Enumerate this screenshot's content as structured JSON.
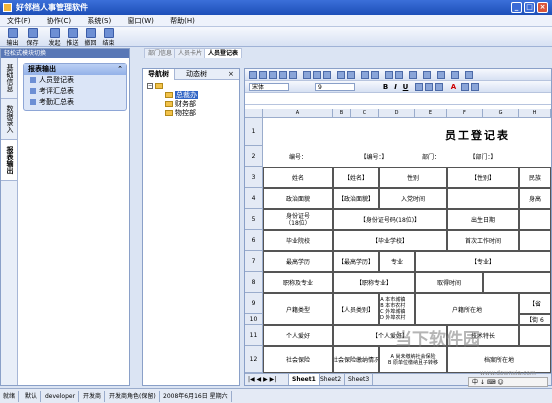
{
  "app": {
    "title": "好邻档人事管理软件",
    "controls": [
      "_",
      "□",
      "×"
    ]
  },
  "menu": [
    "文件(F)",
    "协作(C)",
    "系统(S)",
    "窗口(W)",
    "帮助(H)"
  ],
  "toolbar": [
    "输出",
    "保存",
    "发起",
    "推送",
    "撤回",
    "结束"
  ],
  "left_panel": {
    "title": "轻松式模块切换",
    "vtabs": [
      "基础信息",
      "数据录入",
      "报表输出"
    ],
    "active_vtab": "报表输出",
    "section": {
      "title": "报表输出",
      "items": [
        "人员登记表",
        "考评汇总表",
        "考勤汇总表"
      ]
    }
  },
  "doc_tabs": [
    "部门信息",
    "人员卡片",
    "人员登记表"
  ],
  "tree": {
    "tabs": [
      "导航树",
      "动态树"
    ],
    "root": "",
    "nodes": [
      "总裁办",
      "财务部",
      "物控部"
    ]
  },
  "sheet": {
    "font_name": "宋体",
    "font_size": "9",
    "columns": [
      "A",
      "B",
      "C",
      "D",
      "E",
      "F",
      "G",
      "H"
    ],
    "rows": [
      "1",
      "2",
      "3",
      "4",
      "5",
      "6",
      "7",
      "8",
      "9",
      "10",
      "11",
      "12"
    ],
    "title": "员工登记表",
    "cells": {
      "c_r2a": "编号：",
      "c_r2b": "【编号：】",
      "c_r2c": "部门：",
      "c_r2d": "【部门：】",
      "c_r3a": "姓名",
      "c_r3b": "【姓名】",
      "c_r3c": "性别",
      "c_r3d": "【性别】",
      "c_r3e": "民族",
      "c_r4a": "政治面貌",
      "c_r4b": "【政治面貌】",
      "c_r4c": "入党时间",
      "c_r4e": "身高",
      "c_r5a": "身份证号\n（18位）",
      "c_r5b": "【身份证号码(18位)】",
      "c_r5c": "出生日期",
      "c_r6a": "毕业院校",
      "c_r6b": "【毕业学校】",
      "c_r6c": "首次工作时间",
      "c_r7a": "最高学历",
      "c_r7b": "【最高学历】",
      "c_r7c": "专业",
      "c_r7d": "【专业】",
      "c_r8a": "职称及专业",
      "c_r8b": "【职称专业】",
      "c_r8c": "取得时间",
      "c_r9a": "户籍类型",
      "c_r9b": "【人员类别】",
      "c_r9c": "A 本市城镇\nB 本市农村\nC 外埠城镇\nD 外埠农村",
      "c_r9d": "户籍所在地",
      "c_r9e": "【省",
      "c_r10e": "【街 6",
      "c_r11a": "个人爱好",
      "c_r11b": "【个人爱好】",
      "c_r11c": "技术特长",
      "c_r12a": "社会保险",
      "c_r12b": "【社会保险缴纳情况】",
      "c_r12c": "A 尚未缴纳社会保险\nB 原单位缴纳且子转移",
      "c_r12d": "档案所在地"
    },
    "sheet_tabs": [
      "Sheet1",
      "Sheet2",
      "Sheet3"
    ]
  },
  "status": [
    "就绪",
    "默认",
    "developer",
    "开发商",
    "开发商角色(保留)",
    "2008年6月16日 星期六"
  ],
  "watermark": {
    "text": "当下软件园",
    "url": "www.downxia.com"
  },
  "ime": "中 ↓ ⌨ ☺"
}
